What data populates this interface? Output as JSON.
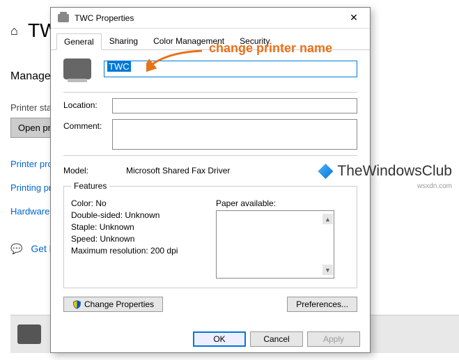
{
  "background": {
    "title_prefix": "TW",
    "manage": "Manage",
    "status_label": "Printer sta",
    "open_queue": "Open pr",
    "links": [
      "Printer pro",
      "Printing pr",
      "Hardware"
    ],
    "get_help": "Get h"
  },
  "watermark": {
    "text": "TheWindowsClub",
    "sub": "wsxdn.com"
  },
  "annotation": {
    "text": "change printer name"
  },
  "dialog": {
    "title": "TWC Properties",
    "tabs": [
      "General",
      "Sharing",
      "Color Management",
      "Security"
    ],
    "active_tab": 0,
    "printer_name": "TWC",
    "location_label": "Location:",
    "location_value": "",
    "comment_label": "Comment:",
    "comment_value": "",
    "model_label": "Model:",
    "model_value": "Microsoft Shared Fax Driver",
    "features": {
      "legend": "Features",
      "color": "Color: No",
      "double_sided": "Double-sided: Unknown",
      "staple": "Staple: Unknown",
      "speed": "Speed: Unknown",
      "max_res": "Maximum resolution: 200 dpi",
      "paper_label": "Paper available:"
    },
    "buttons": {
      "change_props": "Change Properties",
      "preferences": "Preferences...",
      "ok": "OK",
      "cancel": "Cancel",
      "apply": "Apply"
    }
  }
}
